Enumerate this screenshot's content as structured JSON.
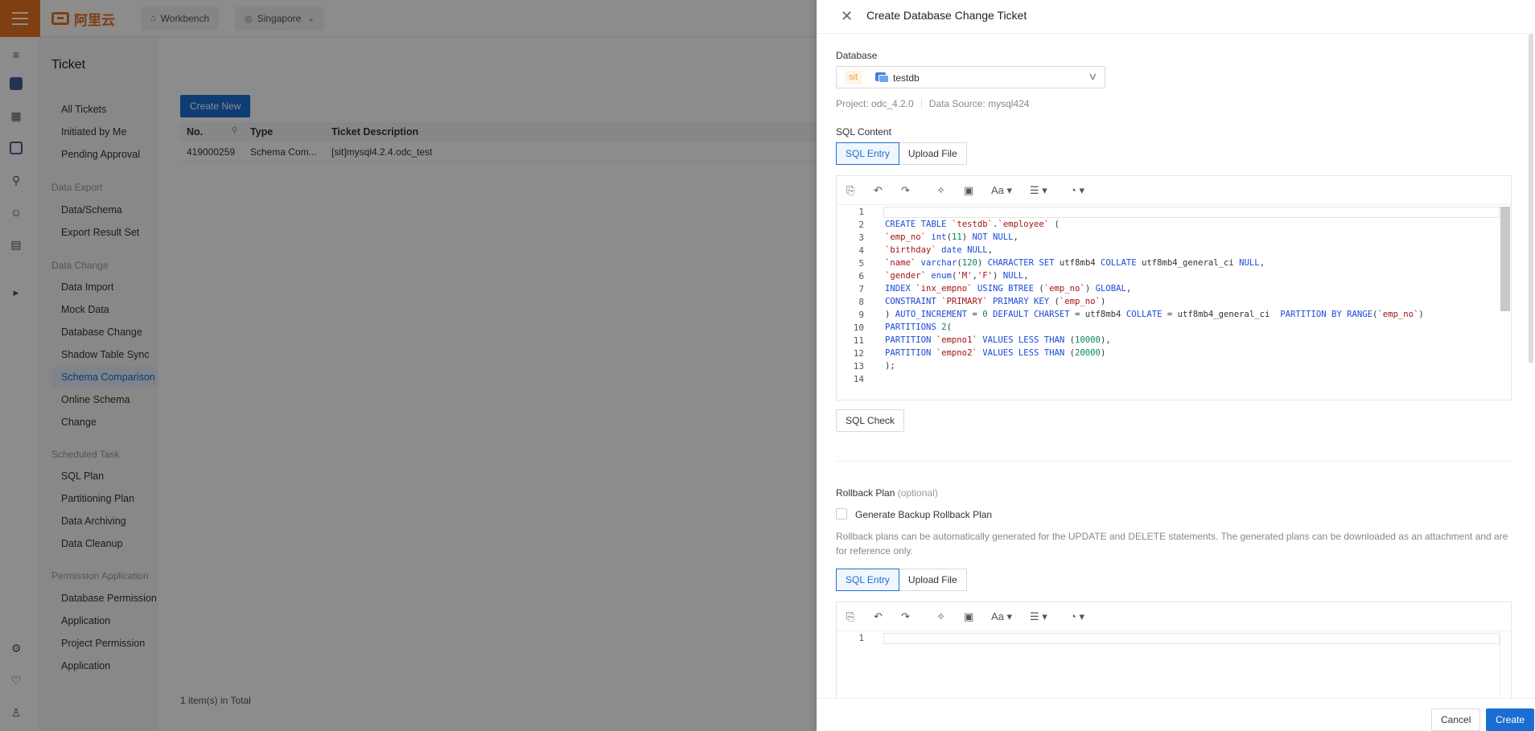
{
  "topbar": {
    "logo": "阿里云",
    "workbench": "Workbench",
    "region": "Singapore"
  },
  "page": {
    "title": "Ticket"
  },
  "menu": {
    "items_top": [
      "All Tickets",
      "Initiated by Me",
      "Pending Approval"
    ],
    "group_export": "Data Export",
    "items_export": [
      "Data/Schema",
      "Export Result Set"
    ],
    "group_change": "Data Change",
    "items_change": [
      "Data Import",
      "Mock Data",
      "Database Change",
      "Shadow Table Sync",
      "Schema Comparison",
      "Online Schema",
      "Change"
    ],
    "group_scheduled": "Scheduled Task",
    "items_scheduled": [
      "SQL Plan",
      "Partitioning Plan",
      "Data Archiving",
      "Data Cleanup"
    ],
    "group_permission": "Permission Application",
    "items_permission": [
      "Database Permission",
      "Application",
      "Project Permission",
      "Application"
    ]
  },
  "list": {
    "create_new": "Create New",
    "columns": [
      "No.",
      "Type",
      "Ticket Description"
    ],
    "rows": [
      [
        "419000259",
        "Schema Com...",
        "[sit]mysql4.2.4.odc_test"
      ]
    ],
    "total": "1 item(s) in Total"
  },
  "drawer": {
    "title": "Create Database Change Ticket",
    "database_label": "Database",
    "db_env_tag": "sit",
    "db_name": "testdb",
    "project_meta": "Project: odc_4.2.0",
    "datasource_meta": "Data Source: mysql424",
    "sql_content_label": "SQL Content",
    "seg_sql_entry": "SQL Entry",
    "seg_upload": "Upload File",
    "toolbar_font": "Aa",
    "sql_check": "SQL Check",
    "rollback_label": "Rollback Plan",
    "rollback_optional": "(optional)",
    "gen_backup": "Generate Backup Rollback Plan",
    "rollback_hint": "Rollback plans can be automatically generated for the UPDATE and DELETE statements. The generated plans can be downloaded as an attachment and are for reference only.",
    "cancel": "Cancel",
    "create": "Create"
  },
  "code": {
    "line_numbers": [
      "1",
      "2",
      "3",
      "4",
      "5",
      "6",
      "7",
      "8",
      "9",
      "10",
      "11",
      "12",
      "13",
      "14"
    ],
    "rollback_line_numbers": [
      "1"
    ]
  }
}
